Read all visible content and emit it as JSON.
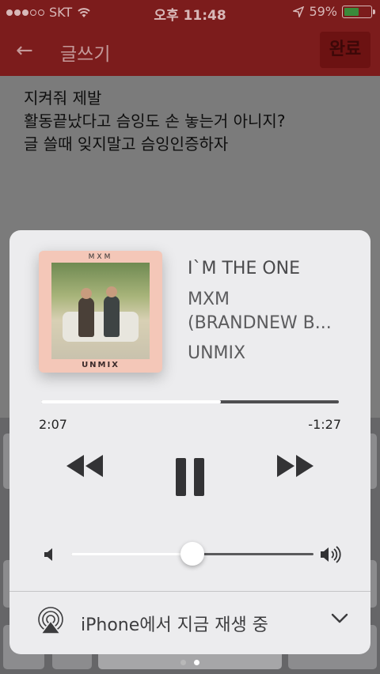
{
  "status_bar": {
    "carrier": "SKT",
    "time": "오후 11:48",
    "battery_percent": "59%",
    "battery_level": 0.59
  },
  "app_bar": {
    "title": "글쓰기",
    "done_label": "완료"
  },
  "compose": {
    "lines": [
      "지켜줘 제발",
      "활동끝났다고 슴잉도 손 놓는거 아니지?",
      "글 쓸때 잊지말고 슴잉인증하자"
    ]
  },
  "now_playing": {
    "album_art_text_top": "MXM",
    "album_art_text_bottom": "UNMIX",
    "song": "I`M THE ONE",
    "artist_line1": "MXM",
    "artist_line2": "(BRANDNEW B...",
    "album": "UNMIX",
    "elapsed": "2:07",
    "remaining": "-1:27",
    "progress": 0.605,
    "volume": 0.5
  },
  "output": {
    "label": "iPhone에서 지금 재생 중"
  },
  "icons": {
    "back": "back-arrow-icon",
    "wifi": "wifi-icon",
    "location": "location-arrow-icon",
    "rewind": "rewind-icon",
    "pause": "pause-icon",
    "fast_forward": "fast-forward-icon",
    "volume_low": "speaker-low-icon",
    "volume_high": "speaker-high-icon",
    "airplay": "airplay-icon",
    "chevron": "chevron-down-icon"
  },
  "colors": {
    "app_bar": "#7c1c1c",
    "card": "#ececee"
  }
}
